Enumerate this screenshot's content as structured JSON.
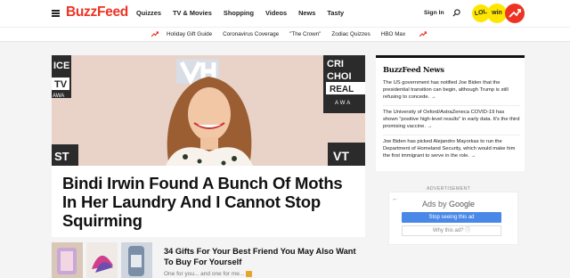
{
  "header": {
    "logo": "BuzzFeed",
    "nav": [
      "Quizzes",
      "TV & Movies",
      "Shopping",
      "Videos",
      "News",
      "Tasty"
    ],
    "signin": "Sign In",
    "badges": {
      "lol": "LOL",
      "win": "win"
    }
  },
  "subnav": {
    "items": [
      "Holiday Gift Guide",
      "Coronavirus Coverage",
      "\"The Crown\"",
      "Zodiac Quizzes",
      "HBO Max"
    ]
  },
  "hero": {
    "title": "Bindi Irwin Found A Bunch Of Moths In Her Laundry And I Cannot Stop Squirming",
    "backdrop_words": [
      "ICE",
      "TV",
      "AWA",
      "CRI",
      "CHOI",
      "REAL",
      "AWA",
      "ST",
      "VT"
    ]
  },
  "list_item": {
    "title": "34 Gifts For Your Best Friend You May Also Want To Buy For Yourself",
    "subtitle": "One for you... and one for me..."
  },
  "sidebar": {
    "news_logo": "BuzzFeed News",
    "news": [
      "The US government has notified Joe Biden that the presidential transition can begin, although Trump is still refusing to concede. →",
      "The University of Oxford/AstraZeneca COVID-19 has shown \"positive high-level results\" in early data. It's the third promising vaccine. →",
      "Joe Biden has picked Alejandro Mayorkas to run the Department of Homeland Security, which would make him the first immigrant to serve in the role. →"
    ],
    "ad_label": "ADVERTISEMENT",
    "ads_by": "Ads by",
    "ads_brand": "Google",
    "stop_label": "Stop seeing this ad",
    "why_label": "Why this ad? ⓘ"
  },
  "colors": {
    "brand": "#ee3322",
    "ad_button": "#4a88e8",
    "badge": "#ffe600"
  }
}
